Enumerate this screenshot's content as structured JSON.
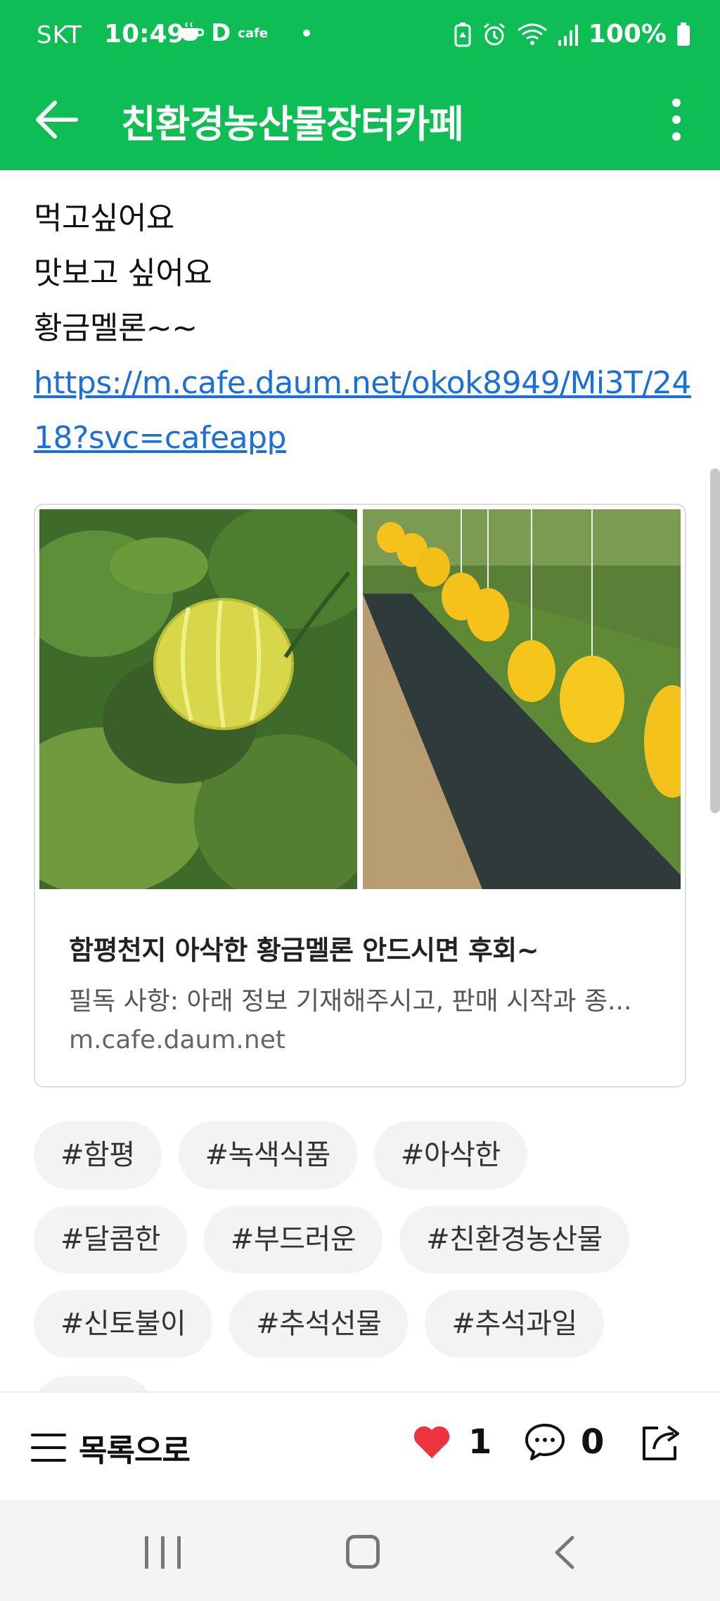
{
  "status_bar": {
    "carrier": "SKT",
    "time": "10:49",
    "cafe_label": "cafe",
    "d_label": "D",
    "battery": "100%"
  },
  "app_bar": {
    "title": "친환경농산물장터카페"
  },
  "post": {
    "lines": [
      "먹고싶어요",
      "맛보고 싶어요",
      "황금멜론~~"
    ],
    "link": "https://m.cafe.daum.net/okok8949/Mi3T/2418?svc=cafeapp"
  },
  "link_card": {
    "title": "함평천지 아삭한 황금멜론 안드시면 후회~",
    "description": "필독 사항: 아래 정보 기재해주시고, 판매 시작과 종...",
    "domain": "m.cafe.daum.net"
  },
  "tags": [
    "#함평",
    "#녹색식품",
    "#아삭한",
    "#달콤한",
    "#부드러운",
    "#친환경농산물",
    "#신토불이",
    "#추석선물",
    "#추석과일"
  ],
  "action_bar": {
    "list_label": "목록으로",
    "like_count": "1",
    "comment_count": "0"
  },
  "colors": {
    "brand_green": "#0fbd55",
    "link_blue": "#1a6fd8",
    "heart_red": "#ee3340"
  },
  "icons": [
    "back-arrow-icon",
    "more-vert-icon",
    "menu-list-icon",
    "heart-icon",
    "comment-icon",
    "share-icon"
  ]
}
